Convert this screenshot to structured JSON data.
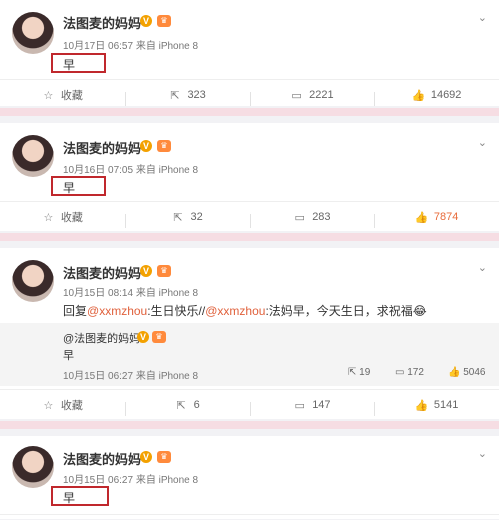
{
  "posts": [
    {
      "author": "法图麦的妈妈",
      "meta": "10月17日 06:57 来自 iPhone 8",
      "text": "早",
      "actions": {
        "fav": "收藏",
        "repost": "323",
        "comment": "2221",
        "like": "14692"
      }
    },
    {
      "author": "法图麦的妈妈",
      "meta": "10月16日 07:05 来自 iPhone 8",
      "text": "早",
      "actions": {
        "fav": "收藏",
        "repost": "32",
        "comment": "283",
        "like": "7874"
      }
    },
    {
      "author": "法图麦的妈妈",
      "meta": "10月15日 08:14 来自 iPhone 8",
      "reply_prefix": "回复",
      "mention1": "@xxmzhou",
      "reply_mid": ":生日快乐//",
      "mention2": "@xxmzhou",
      "reply_tail": ":法妈早，今天生日，求祝福😂",
      "quoted": {
        "author": "@法图麦的妈妈",
        "text": "早",
        "meta": "10月15日 06:27 来自 iPhone 8",
        "repost": "19",
        "comment": "172",
        "like": "5046"
      },
      "actions": {
        "fav": "收藏",
        "repost": "6",
        "comment": "147",
        "like": "5141"
      }
    },
    {
      "author": "法图麦的妈妈",
      "meta": "10月15日 06:27 来自 iPhone 8",
      "text": "早"
    }
  ],
  "badges": {
    "v": "V",
    "crown": "♛"
  },
  "icons": {
    "chevron": "chevron-down-icon",
    "fav": "star-icon",
    "repost": "share-icon",
    "comment": "comment-icon",
    "like": "thumb-up-icon"
  },
  "colors": {
    "accent": "#e86b3a",
    "highlight_box": "#c0282d",
    "divider": "#f6dde3"
  }
}
